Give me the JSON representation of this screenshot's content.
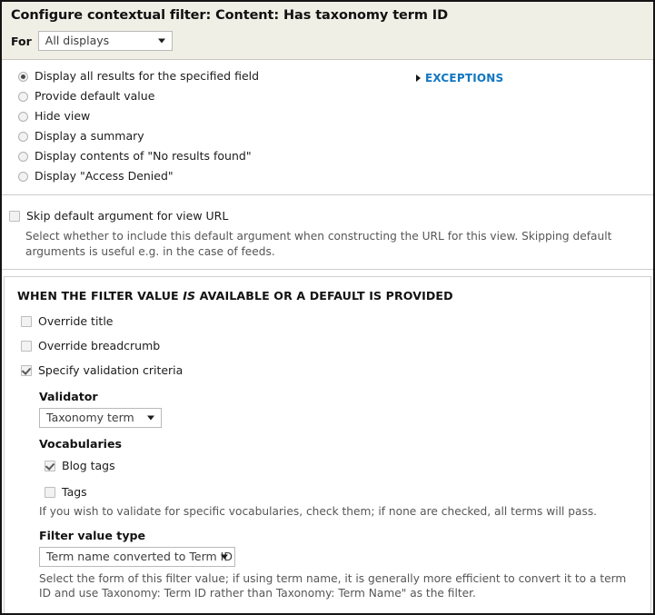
{
  "header": {
    "title": "Configure contextual filter: Content: Has taxonomy term ID",
    "for_label": "For",
    "display_select": {
      "value": "All displays",
      "icon": "chevron-down-icon"
    }
  },
  "options": {
    "radios": [
      {
        "label": "Display all results for the specified field",
        "checked": true
      },
      {
        "label": "Provide default value",
        "checked": false
      },
      {
        "label": "Hide view",
        "checked": false
      },
      {
        "label": "Display a summary",
        "checked": false
      },
      {
        "label": "Display contents of \"No results found\"",
        "checked": false
      },
      {
        "label": "Display \"Access Denied\"",
        "checked": false
      }
    ],
    "exceptions": {
      "label": "EXCEPTIONS",
      "icon": "triangle-right-icon",
      "color": "#0f76c3"
    }
  },
  "skip_section": {
    "checkbox_label": "Skip default argument for view URL",
    "checked": false,
    "description": "Select whether to include this default argument when constructing the URL for this view. Skipping default arguments is useful e.g. in the case of feeds."
  },
  "when_value": {
    "heading_before": "WHEN THE FILTER VALUE ",
    "heading_italic": "IS",
    "heading_after": " AVAILABLE OR A DEFAULT IS PROVIDED",
    "checkboxes": [
      {
        "label": "Override title",
        "checked": false
      },
      {
        "label": "Override breadcrumb",
        "checked": false
      },
      {
        "label": "Specify validation criteria",
        "checked": true
      }
    ],
    "validator": {
      "label": "Validator",
      "value": "Taxonomy term",
      "icon": "chevron-down-icon"
    },
    "vocabularies": {
      "label": "Vocabularies",
      "items": [
        {
          "label": "Blog tags",
          "checked": true
        },
        {
          "label": "Tags",
          "checked": false
        }
      ],
      "help": "If you wish to validate for specific vocabularies, check them; if none are checked, all terms will pass."
    },
    "filter_value_type": {
      "label": "Filter value type",
      "value": "Term name converted to Term ID",
      "icon": "chevron-down-icon",
      "help": "Select the form of this filter value; if using term name, it is generally more efficient to convert it to a term ID and use Taxonomy: Term ID rather than Taxonomy: Term Name\" as the filter."
    }
  }
}
